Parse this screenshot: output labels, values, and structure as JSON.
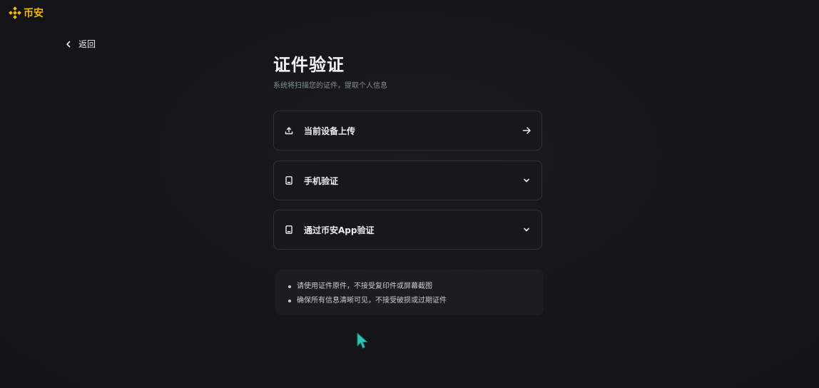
{
  "brand": {
    "name": "币安",
    "color": "#f0b90b"
  },
  "nav": {
    "back_label": "返回"
  },
  "main": {
    "title": "证件验证",
    "subtitle": "系统将扫描您的证件，提取个人信息",
    "options": [
      {
        "label": "当前设备上传",
        "icon": "upload-icon",
        "trailing_icon": "arrow-right-icon"
      },
      {
        "label": "手机验证",
        "icon": "phone-icon",
        "trailing_icon": "chevron-down-icon"
      },
      {
        "label": "通过币安App验证",
        "icon": "phone-icon",
        "trailing_icon": "chevron-down-icon"
      }
    ],
    "notes": [
      "请使用证件原件，不接受复印件或屏幕截图",
      "确保所有信息清晰可见，不接受破损或过期证件"
    ]
  },
  "colors": {
    "background": "#151517",
    "card_border": "#2f3138",
    "cursor": "#2ec4b6"
  }
}
